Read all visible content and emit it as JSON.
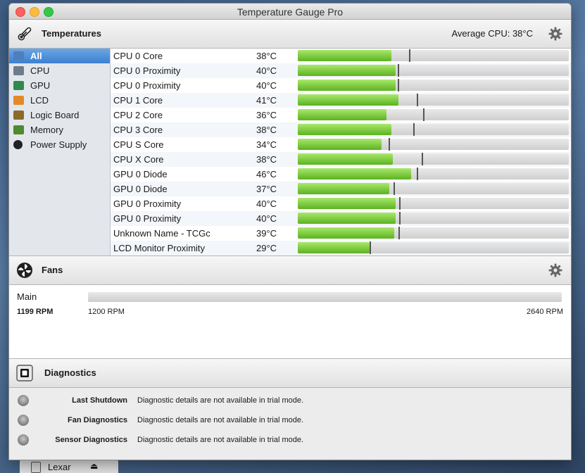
{
  "window": {
    "title": "Temperature Gauge Pro"
  },
  "temperatures": {
    "title": "Temperatures",
    "average_label": "Average CPU:",
    "average_value": "38°C",
    "categories": [
      {
        "label": "All",
        "icon": "all-icon",
        "selected": true
      },
      {
        "label": "CPU",
        "icon": "cpu-icon"
      },
      {
        "label": "GPU",
        "icon": "gpu-icon"
      },
      {
        "label": "LCD",
        "icon": "lcd-icon"
      },
      {
        "label": "Logic Board",
        "icon": "logic-board-icon"
      },
      {
        "label": "Memory",
        "icon": "memory-icon"
      },
      {
        "label": "Power Supply",
        "icon": "power-icon"
      }
    ],
    "sensors": [
      {
        "name": "CPU 0 Core",
        "value": "38°C",
        "level": 0.346,
        "peak": 0.41
      },
      {
        "name": "CPU 0 Proximity",
        "value": "40°C",
        "level": 0.362,
        "peak": 0.368
      },
      {
        "name": "CPU 0 Proximity",
        "value": "40°C",
        "level": 0.362,
        "peak": 0.368
      },
      {
        "name": "CPU 1 Core",
        "value": "41°C",
        "level": 0.372,
        "peak": 0.438
      },
      {
        "name": "CPU 2 Core",
        "value": "36°C",
        "level": 0.328,
        "peak": 0.462
      },
      {
        "name": "CPU 3 Core",
        "value": "38°C",
        "level": 0.346,
        "peak": 0.425
      },
      {
        "name": "CPU S Core",
        "value": "34°C",
        "level": 0.308,
        "peak": 0.335
      },
      {
        "name": "CPU X Core",
        "value": "38°C",
        "level": 0.351,
        "peak": 0.458
      },
      {
        "name": "GPU 0 Diode",
        "value": "46°C",
        "level": 0.418,
        "peak": 0.438
      },
      {
        "name": "GPU 0 Diode",
        "value": "37°C",
        "level": 0.337,
        "peak": 0.354
      },
      {
        "name": "GPU 0 Proximity",
        "value": "40°C",
        "level": 0.362,
        "peak": 0.374
      },
      {
        "name": "GPU 0 Proximity",
        "value": "40°C",
        "level": 0.362,
        "peak": 0.374
      },
      {
        "name": "Unknown Name - TCGc",
        "value": "39°C",
        "level": 0.355,
        "peak": 0.372
      },
      {
        "name": "LCD Monitor Proximity",
        "value": "29°C",
        "level": 0.265,
        "peak": 0.265
      }
    ]
  },
  "fans": {
    "title": "Fans",
    "items": [
      {
        "name": "Main",
        "rpm": "1199 RPM",
        "min": "1200 RPM",
        "max": "2640 RPM",
        "level": 0
      }
    ]
  },
  "diagnostics": {
    "title": "Diagnostics",
    "rows": [
      {
        "name": "Last Shutdown",
        "text": "Diagnostic details are not available in trial mode."
      },
      {
        "name": "Fan Diagnostics",
        "text": "Diagnostic details are not available in trial mode."
      },
      {
        "name": "Sensor Diagnostics",
        "text": "Diagnostic details are not available in trial mode."
      }
    ]
  },
  "desktop": {
    "drive_label": "Lexar"
  }
}
